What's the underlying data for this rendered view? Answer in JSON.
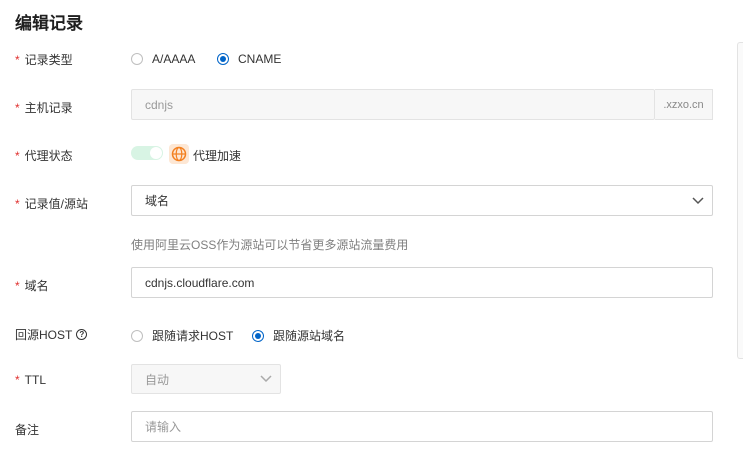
{
  "title": "编辑记录",
  "record_type": {
    "label": "记录类型",
    "options": [
      "A/AAAA",
      "CNAME"
    ],
    "selected": "CNAME"
  },
  "host": {
    "label": "主机记录",
    "value": "cdnjs",
    "suffix": ".xzxo.cn"
  },
  "proxy": {
    "label": "代理状态",
    "toggle_on": true,
    "status_text": "代理加速",
    "icon": "globe-icon"
  },
  "record_value": {
    "label": "记录值/源站",
    "selected": "域名",
    "hint": "使用阿里云OSS作为源站可以节省更多源站流量费用"
  },
  "domain": {
    "label": "域名",
    "value": "cdnjs.cloudflare.com"
  },
  "origin_host": {
    "label": "回源HOST",
    "help_icon": "?",
    "options": [
      "跟随请求HOST",
      "跟随源站域名"
    ],
    "selected": "跟随源站域名"
  },
  "ttl": {
    "label": "TTL",
    "value": "自动"
  },
  "remark": {
    "label": "备注",
    "placeholder": "请输入"
  },
  "colors": {
    "accent": "#0064c8",
    "required": "#e0312f",
    "toggle": "#d8f4e4",
    "cf_icon_bg": "#fde7d4",
    "cf_icon": "#f38020"
  }
}
